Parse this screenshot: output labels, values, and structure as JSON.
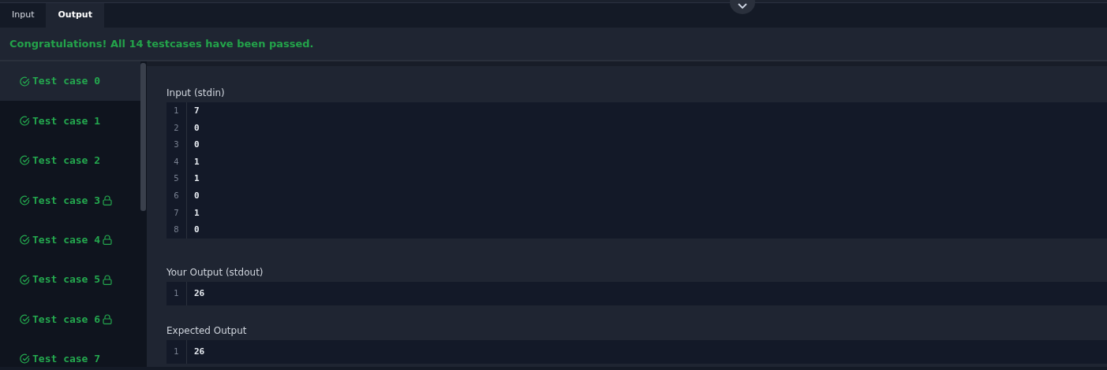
{
  "tabs": [
    {
      "label": "Input",
      "selected": false
    },
    {
      "label": "Output",
      "selected": true
    }
  ],
  "message": "Congratulations! All 14 testcases have been passed.",
  "test_cases": [
    {
      "label": "Test case 0",
      "passed": true,
      "locked": false,
      "selected": true
    },
    {
      "label": "Test case 1",
      "passed": true,
      "locked": false,
      "selected": false
    },
    {
      "label": "Test case 2",
      "passed": true,
      "locked": false,
      "selected": false
    },
    {
      "label": "Test case 3",
      "passed": true,
      "locked": true,
      "selected": false
    },
    {
      "label": "Test case 4",
      "passed": true,
      "locked": true,
      "selected": false
    },
    {
      "label": "Test case 5",
      "passed": true,
      "locked": true,
      "selected": false
    },
    {
      "label": "Test case 6",
      "passed": true,
      "locked": true,
      "selected": false
    },
    {
      "label": "Test case 7",
      "passed": true,
      "locked": false,
      "selected": false
    }
  ],
  "sections": [
    {
      "title": "Input (stdin)",
      "lines": [
        {
          "number": "1",
          "text": "7"
        },
        {
          "number": "2",
          "text": "0"
        },
        {
          "number": "3",
          "text": "0"
        },
        {
          "number": "4",
          "text": "1"
        },
        {
          "number": "5",
          "text": "1"
        },
        {
          "number": "6",
          "text": "0"
        },
        {
          "number": "7",
          "text": "1"
        },
        {
          "number": "8",
          "text": "0"
        }
      ]
    },
    {
      "title": "Your Output (stdout)",
      "lines": [
        {
          "number": "1",
          "text": "26"
        }
      ]
    },
    {
      "title": "Expected Output",
      "lines": [
        {
          "number": "1",
          "text": "26"
        }
      ]
    }
  ]
}
